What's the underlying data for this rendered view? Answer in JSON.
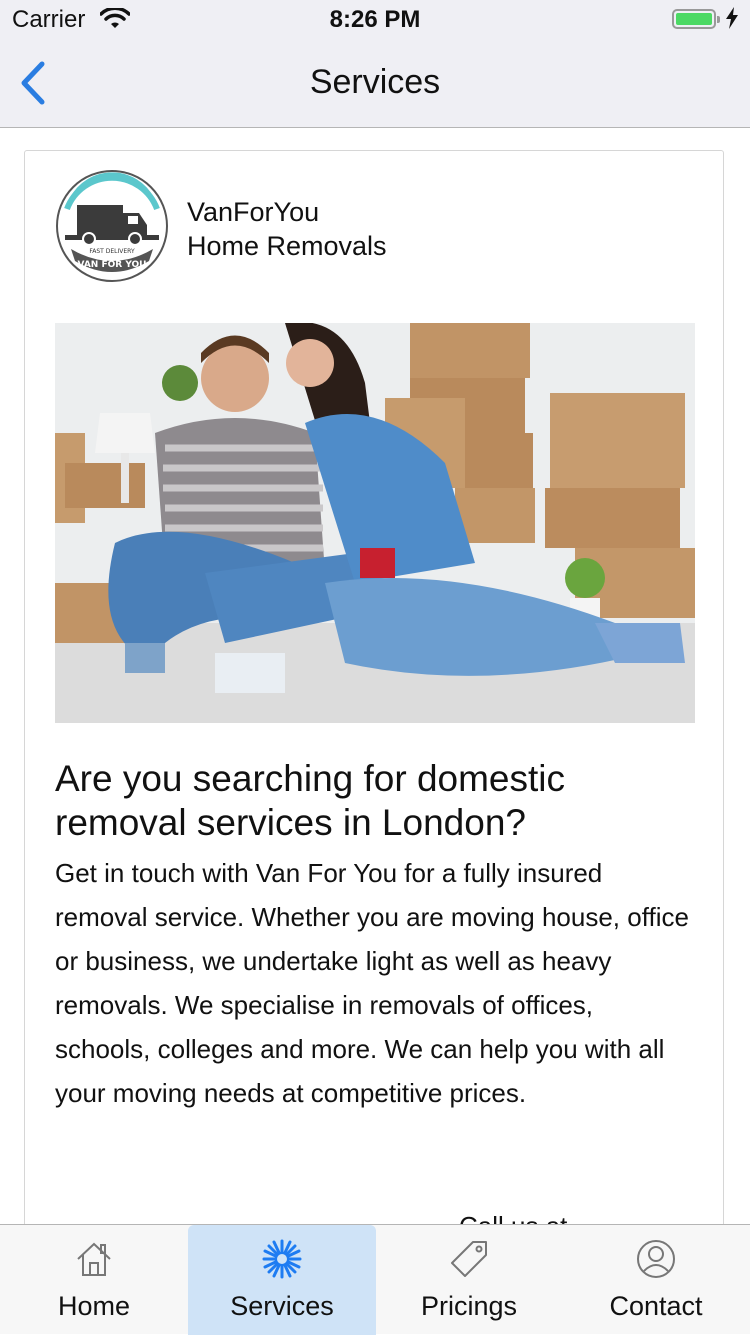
{
  "status_bar": {
    "carrier": "Carrier",
    "time": "8:26 PM",
    "battery_level": 1.0
  },
  "nav": {
    "title": "Services",
    "back_icon": "chevron-left-icon",
    "accent_color": "#2a7de1"
  },
  "company": {
    "name": "VanForYou",
    "subtitle": "Home Removals",
    "logo_text_top": "FAST DELIVERY",
    "logo_text_bottom": "VAN FOR YOU"
  },
  "article": {
    "headline": "Are you searching for domestic removal services in London?",
    "body": "Get in touch with Van For You for a fully insured removal service. Whether you are moving house, office or business, we undertake light as well as heavy removals. We specialise in removals of offices, schools, colleges and more. We can help you with all your moving needs at competitive prices.",
    "call_label": "Call us at"
  },
  "tabs": [
    {
      "label": "Home",
      "icon": "house-icon",
      "active": false
    },
    {
      "label": "Services",
      "icon": "asterisk-flower-icon",
      "active": true
    },
    {
      "label": "Pricings",
      "icon": "price-tag-icon",
      "active": false
    },
    {
      "label": "Contact",
      "icon": "user-circle-icon",
      "active": false
    }
  ],
  "colors": {
    "active_tab_bg": "#cfe3f7",
    "active_icon": "#1e7cf2",
    "battery": "#4cd964"
  }
}
